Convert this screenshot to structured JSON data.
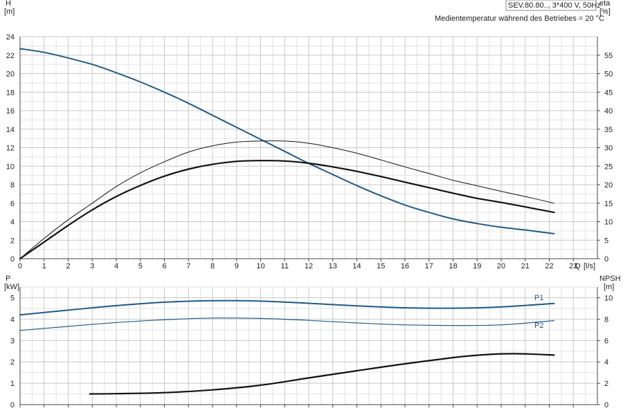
{
  "header": {
    "model": "SEV.80.80.., 3*400 V, 50Hz",
    "note": "Medientemperatur während des Betriebes = 20 °C"
  },
  "chart_data": [
    {
      "type": "line",
      "x_axis": {
        "label": "Q",
        "unit": "[l/s]",
        "range": [
          0,
          24
        ],
        "ticks": [
          0,
          1,
          2,
          3,
          4,
          5,
          6,
          7,
          8,
          9,
          10,
          11,
          12,
          13,
          14,
          15,
          16,
          17,
          18,
          19,
          20,
          21,
          22,
          23
        ]
      },
      "y_axis_left": {
        "label": "H",
        "unit": "[m]",
        "range": [
          0,
          24
        ],
        "ticks": [
          0,
          2,
          4,
          6,
          8,
          10,
          12,
          14,
          16,
          18,
          20,
          22,
          24
        ]
      },
      "y_axis_right": {
        "label": "eta",
        "unit": "[%]",
        "range": [
          0,
          60
        ],
        "ticks": [
          0,
          5,
          10,
          15,
          20,
          25,
          30,
          35,
          40,
          45,
          50,
          55
        ]
      },
      "grid": true,
      "series": [
        {
          "axis": "left",
          "color": "#1c5a8a",
          "width": 2,
          "x": [
            0,
            1,
            2,
            3,
            4,
            5,
            6,
            7,
            8,
            9,
            10,
            11,
            12,
            13,
            14,
            15,
            16,
            17,
            18,
            19,
            20,
            21,
            22.2
          ],
          "y": [
            22.7,
            22.3,
            21.7,
            21.0,
            20.1,
            19.1,
            18.0,
            16.8,
            15.5,
            14.2,
            12.9,
            11.6,
            10.3,
            9.1,
            7.9,
            6.8,
            5.8,
            5.0,
            4.3,
            3.8,
            3.4,
            3.1,
            2.7
          ]
        },
        {
          "axis": "right",
          "color": "#111111",
          "width": 1,
          "x": [
            0,
            1,
            2,
            3,
            4,
            5,
            6,
            7,
            8,
            9,
            10,
            11,
            12,
            13,
            14,
            15,
            16,
            17,
            18,
            19,
            20,
            21,
            22.2
          ],
          "y": [
            0,
            5.5,
            10.5,
            15.0,
            19.5,
            23.2,
            26.2,
            28.8,
            30.5,
            31.5,
            31.8,
            31.8,
            31.2,
            30.0,
            28.5,
            26.7,
            24.8,
            23.0,
            21.2,
            19.7,
            18.2,
            16.8,
            15.0
          ]
        },
        {
          "axis": "right",
          "color": "#111111",
          "width": 2.2,
          "x": [
            0,
            1,
            2,
            3,
            4,
            5,
            6,
            7,
            8,
            9,
            10,
            11,
            12,
            13,
            14,
            15,
            16,
            17,
            18,
            19,
            20,
            21,
            22.2
          ],
          "y": [
            0,
            4.5,
            9.0,
            13.2,
            16.8,
            19.8,
            22.3,
            24.2,
            25.5,
            26.3,
            26.5,
            26.4,
            25.8,
            24.8,
            23.6,
            22.2,
            20.7,
            19.2,
            17.7,
            16.3,
            15.2,
            14.0,
            12.5
          ]
        }
      ]
    },
    {
      "type": "line",
      "x_axis": {
        "range": [
          0,
          24
        ],
        "ticks": [
          0,
          1,
          2,
          3,
          4,
          5,
          6,
          7,
          8,
          9,
          10,
          11,
          12,
          13,
          14,
          15,
          16,
          17,
          18,
          19,
          20,
          21,
          22,
          23
        ]
      },
      "y_axis_left": {
        "label": "P",
        "unit": "[kW]",
        "range": [
          0,
          5.5
        ],
        "ticks": [
          0,
          1,
          2,
          3,
          4,
          5
        ]
      },
      "y_axis_right": {
        "label": "NPSH",
        "unit": "[m]",
        "range": [
          0,
          11
        ],
        "ticks": [
          0,
          2,
          4,
          6,
          8,
          10
        ]
      },
      "grid": true,
      "series": [
        {
          "name": "P1",
          "axis": "left",
          "color": "#1c5a8a",
          "width": 2,
          "x": [
            0,
            2,
            4,
            6,
            8,
            10,
            12,
            14,
            16,
            18,
            20,
            22.2
          ],
          "y": [
            4.2,
            4.42,
            4.63,
            4.79,
            4.86,
            4.84,
            4.74,
            4.62,
            4.53,
            4.51,
            4.57,
            4.73
          ]
        },
        {
          "name": "P2",
          "axis": "left",
          "color": "#1c5a8a",
          "width": 1.2,
          "x": [
            0,
            2,
            4,
            6,
            8,
            10,
            12,
            14,
            16,
            18,
            20,
            22.2
          ],
          "y": [
            3.47,
            3.66,
            3.84,
            3.97,
            4.05,
            4.03,
            3.94,
            3.82,
            3.73,
            3.7,
            3.73,
            3.93
          ]
        },
        {
          "axis": "right",
          "color": "#111111",
          "width": 2.2,
          "x": [
            2.9,
            4,
            6,
            8,
            10,
            12,
            14,
            16,
            18,
            19,
            20,
            21,
            22.2
          ],
          "y": [
            1.0,
            1.02,
            1.12,
            1.38,
            1.82,
            2.5,
            3.17,
            3.82,
            4.4,
            4.62,
            4.75,
            4.75,
            4.63
          ]
        }
      ]
    }
  ]
}
